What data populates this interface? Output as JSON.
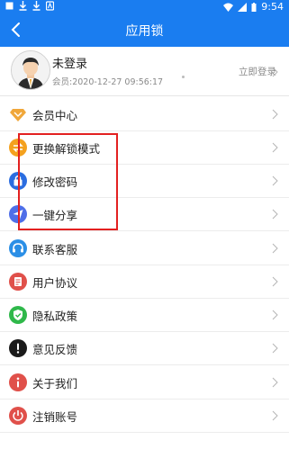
{
  "status_bar": {
    "time": "9:54"
  },
  "app_bar": {
    "title": "应用锁"
  },
  "profile": {
    "name": "未登录",
    "member_info": "会员:2020-12-27 09:56:17",
    "login_label": "立即登录"
  },
  "menu": {
    "items": [
      {
        "label": "会员中心",
        "icon": "diamond-icon",
        "color": "#f0a73a"
      },
      {
        "label": "更换解锁模式",
        "icon": "swap-icon",
        "color": "#f4a11e"
      },
      {
        "label": "修改密码",
        "icon": "lock-icon",
        "color": "#2b6de0"
      },
      {
        "label": "一键分享",
        "icon": "send-icon",
        "color": "#4f6ee8"
      },
      {
        "label": "联系客服",
        "icon": "headset-icon",
        "color": "#2b8fe6"
      },
      {
        "label": "用户协议",
        "icon": "document-icon",
        "color": "#e0504a"
      },
      {
        "label": "隐私政策",
        "icon": "shield-icon",
        "color": "#2fb84a"
      },
      {
        "label": "意见反馈",
        "icon": "exclamation-icon",
        "color": "#1a1a1a"
      },
      {
        "label": "关于我们",
        "icon": "info-icon",
        "color": "#e0504a"
      },
      {
        "label": "注销账号",
        "icon": "power-icon",
        "color": "#e0504a"
      }
    ]
  },
  "colors": {
    "primary": "#1a7df0",
    "highlight": "#e32020"
  }
}
